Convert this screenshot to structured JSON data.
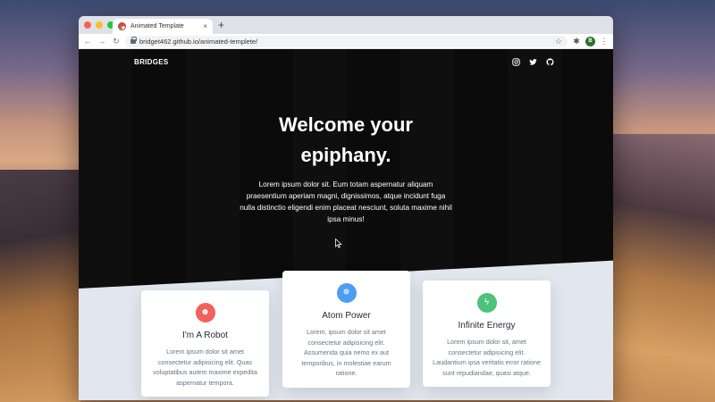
{
  "browser": {
    "tab_title": "Animated Template",
    "tab_close": "×",
    "new_tab": "+",
    "url": "bridget462.github.io/animated-templete/",
    "back": "←",
    "forward": "→",
    "reload": "↻",
    "star": "☆",
    "extensions": "✱",
    "menu": "⋮",
    "avatar": "B"
  },
  "site": {
    "brand": "BRIDGES",
    "socials": [
      "instagram-icon",
      "twitter-icon",
      "github-icon"
    ],
    "hero": {
      "title_line1": "Welcome your",
      "title_line2": "epiphany.",
      "text": "Lorem ipsum dolor sit. Eum totam aspernatur aliquam praesentium aperiam magni, dignissimos, atque incidunt fuga nulla distinctio eligendi enim placeat nesciunt, soluta maxime nihil ipsa minus!"
    },
    "cards": [
      {
        "title": "I'm A Robot",
        "text": "Lorem ipsum dolor sit amet consectetur adipisicing elit. Quas voluptatibus autem maxime expedita aspernatur tempora.",
        "icon": "robot-icon",
        "icon_glyph": "☻",
        "color": "#f0625c"
      },
      {
        "title": "Atom Power",
        "text": "Lorem, ipsum dolor sit amet consectetur adipisicing elit. Assumenda quia nemo ex aut temporibus, in molestiae earum ratione.",
        "icon": "atom-icon",
        "icon_glyph": "✵",
        "color": "#4d9ef2"
      },
      {
        "title": "Infinite Energy",
        "text": "Lorem ipsum dolor sit, amet consectetur adipisicing elit. Laudantium ipsa veritatis error ratione sunt repudiandae, quasi atque.",
        "icon": "lightning-icon",
        "icon_glyph": "ϟ",
        "color": "#4cc27a"
      }
    ]
  }
}
